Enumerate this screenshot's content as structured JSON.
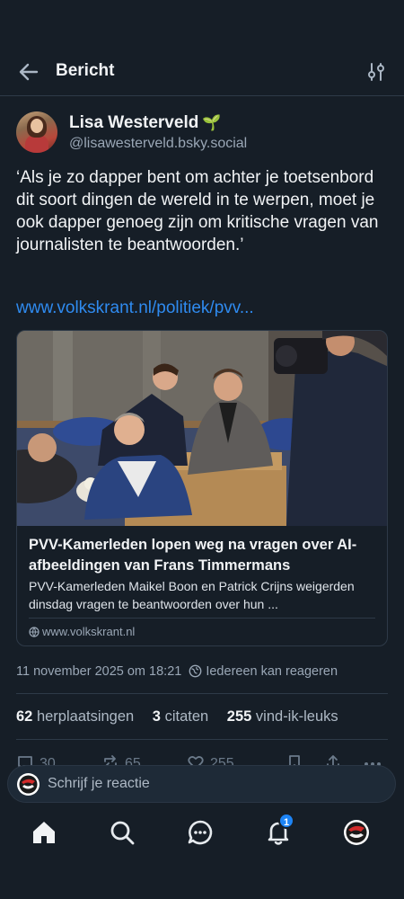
{
  "header": {
    "title": "Bericht",
    "back_icon": "arrow-left-icon",
    "filter_icon": "sliders-icon"
  },
  "author": {
    "name": "Lisa Westerveld",
    "emoji": "🌱",
    "handle": "@lisawesterveld.bsky.social"
  },
  "post": {
    "text": "‘Als je zo dapper bent om achter je toetsenbord dit soort dingen de wereld in te werpen, moet je ook dapper genoeg zijn om kritische vragen van journalisten te beantwoorden.’",
    "link": "www.volkskrant.nl/politiek/pvv..."
  },
  "card": {
    "title": "PVV-Kamerleden lopen weg na vragen over AI-afbeeldingen van Frans Timmermans",
    "description": "PVV-Kamerleden Maikel Boon en Patrick Crijns weigerden dinsdag vragen te beantwoorden over hun ...",
    "source": "www.volkskrant.nl"
  },
  "meta": {
    "timestamp": "11 november 2025 om 18:21",
    "reply_setting": "Iedereen kan reageren"
  },
  "stats": {
    "reposts_count": "62",
    "reposts_label": "herplaatsingen",
    "quotes_count": "3",
    "quotes_label": "citaten",
    "likes_count": "255",
    "likes_label": "vind-ik-leuks"
  },
  "actions": {
    "reply_count": "30",
    "repost_count": "65",
    "like_count": "255"
  },
  "reply": {
    "placeholder": "Schrijf je reactie"
  },
  "nav": {
    "notifications_badge": "1"
  },
  "colors": {
    "background": "#161e27",
    "accent": "#2f8bf0",
    "badge": "#1d84f5",
    "muted": "#9aa7b6"
  }
}
